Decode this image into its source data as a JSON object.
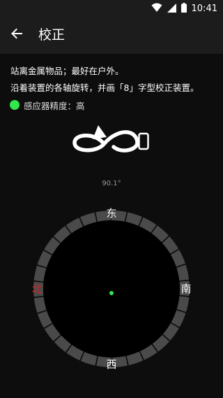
{
  "status_bar": {
    "time": "10:41",
    "icons": [
      "wifi-icon",
      "signal-icon",
      "battery-icon"
    ]
  },
  "app_bar": {
    "title": "校正",
    "back_icon": "arrow-left-icon"
  },
  "instructions": {
    "line1": "站离金属物品；最好在户外。",
    "line2": "沿着装置的各轴旋转，并画「8」字型校正装置。"
  },
  "accuracy": {
    "label": "感应器精度：高",
    "indicator_color": "#33e64c"
  },
  "figure8": {
    "icon": "figure-eight-phone-icon"
  },
  "compass": {
    "heading": "90.1°",
    "directions": {
      "north": "北",
      "east": "东",
      "south": "南",
      "west": "西"
    },
    "north_color": "#e01f1f",
    "needle_color": "#33e64c"
  }
}
